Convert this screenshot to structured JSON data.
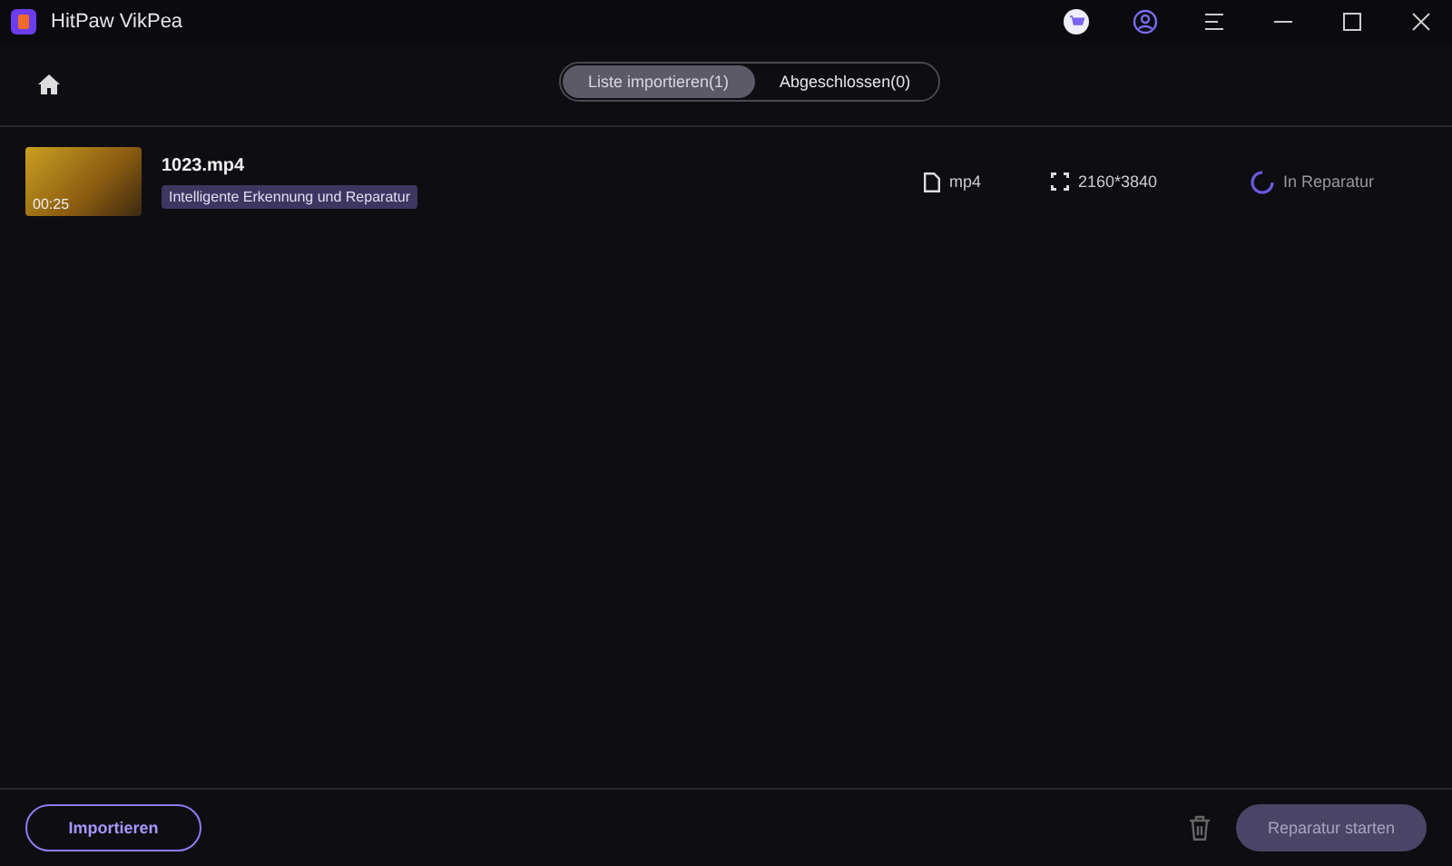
{
  "window": {
    "title": "HitPaw VikPea"
  },
  "tabs": [
    {
      "label": "Liste importieren(1)",
      "selected": true
    },
    {
      "label": "Abgeschlossen(0)",
      "selected": false
    }
  ],
  "files": [
    {
      "name": "1023.mp4",
      "duration": "00:25",
      "tag": "Intelligente Erkennung und Reparatur",
      "format": "mp4",
      "resolution": "2160*3840",
      "status": "In Reparatur"
    }
  ],
  "footer": {
    "import_button": "Importieren",
    "start_button": {
      "label": "Reparatur starten",
      "disabled": true
    }
  }
}
